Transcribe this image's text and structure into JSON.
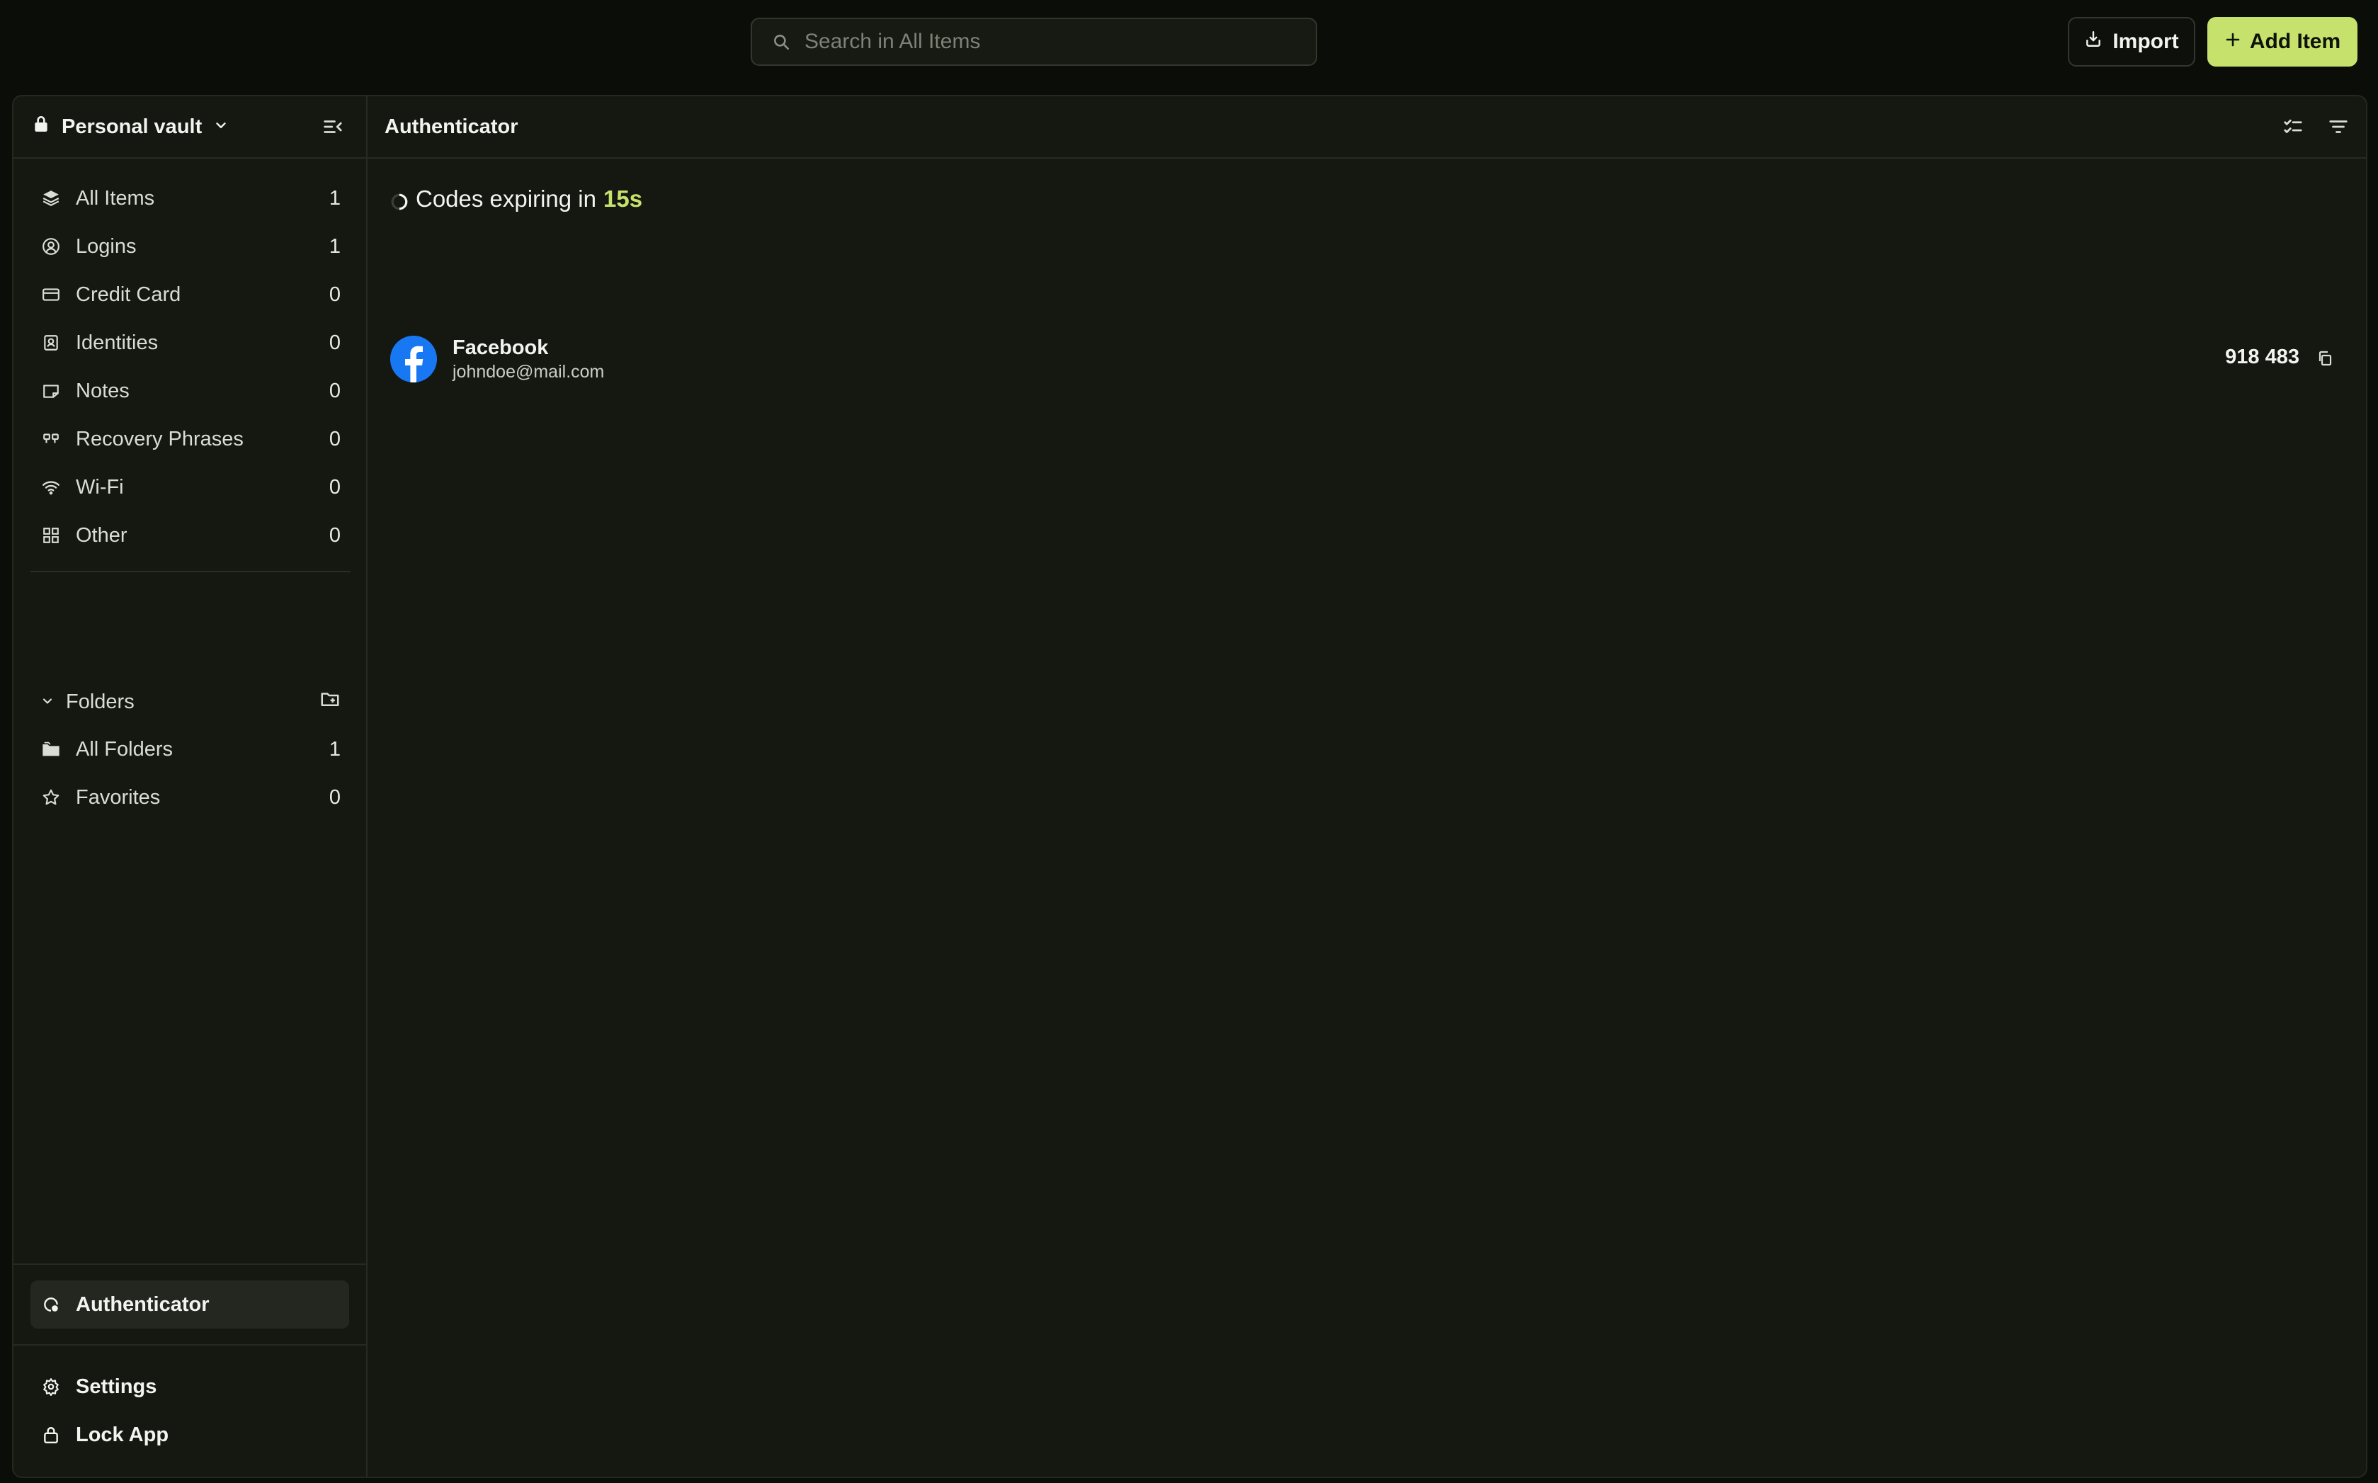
{
  "search": {
    "placeholder": "Search in All Items"
  },
  "toolbar": {
    "import_label": "Import",
    "add_item_label": "Add Item"
  },
  "sidebar": {
    "vault_name": "Personal vault",
    "items": [
      {
        "label": "All Items",
        "count": "1",
        "icon": "layers-icon"
      },
      {
        "label": "Logins",
        "count": "1",
        "icon": "user-circle-icon"
      },
      {
        "label": "Credit Card",
        "count": "0",
        "icon": "credit-card-icon"
      },
      {
        "label": "Identities",
        "count": "0",
        "icon": "id-badge-icon"
      },
      {
        "label": "Notes",
        "count": "0",
        "icon": "note-icon"
      },
      {
        "label": "Recovery Phrases",
        "count": "0",
        "icon": "quote-icon"
      },
      {
        "label": "Wi-Fi",
        "count": "0",
        "icon": "wifi-icon"
      },
      {
        "label": "Other",
        "count": "0",
        "icon": "grid-icon"
      }
    ],
    "folders": {
      "label": "Folders",
      "items": [
        {
          "label": "All Folders",
          "count": "1",
          "icon": "folders-icon"
        },
        {
          "label": "Favorites",
          "count": "0",
          "icon": "star-icon"
        }
      ]
    },
    "authenticator_label": "Authenticator",
    "bottom": [
      {
        "label": "Settings",
        "icon": "gear-icon"
      },
      {
        "label": "Lock App",
        "icon": "lock-icon"
      }
    ]
  },
  "main": {
    "title": "Authenticator",
    "expiry_prefix": "Codes expiring in",
    "expiry_seconds": "15s",
    "entries": [
      {
        "title": "Facebook",
        "subtitle": "johndoe@mail.com",
        "code": "918 483",
        "icon": "facebook-icon"
      }
    ]
  },
  "colors": {
    "accent": "#c6e26d",
    "background": "#0a0d08",
    "panel": "#141811",
    "facebook": "#1877f2"
  }
}
